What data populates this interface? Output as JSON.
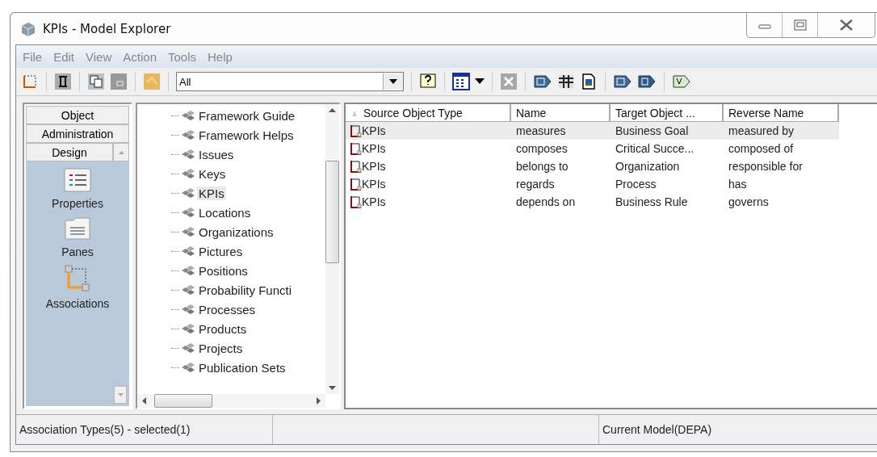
{
  "window": {
    "title": "KPIs - Model Explorer"
  },
  "menu": [
    "File",
    "Edit",
    "View",
    "Action",
    "Tools",
    "Help"
  ],
  "toolbar": {
    "filter_value": "All"
  },
  "nav": {
    "sections": [
      "Object",
      "Administration",
      "Design"
    ],
    "items": [
      {
        "label": "Properties",
        "kind": "properties"
      },
      {
        "label": "Panes",
        "kind": "panes"
      },
      {
        "label": "Associations",
        "kind": "associations"
      }
    ]
  },
  "tree": {
    "items": [
      {
        "label": "Framework Guide",
        "selected": false
      },
      {
        "label": "Framework Helps",
        "selected": false
      },
      {
        "label": "Issues",
        "selected": false
      },
      {
        "label": "Keys",
        "selected": false
      },
      {
        "label": "KPIs",
        "selected": true
      },
      {
        "label": "Locations",
        "selected": false
      },
      {
        "label": "Organizations",
        "selected": false
      },
      {
        "label": "Pictures",
        "selected": false
      },
      {
        "label": "Positions",
        "selected": false
      },
      {
        "label": "Probability Functi",
        "selected": false
      },
      {
        "label": "Processes",
        "selected": false
      },
      {
        "label": "Products",
        "selected": false
      },
      {
        "label": "Projects",
        "selected": false
      },
      {
        "label": "Publication Sets",
        "selected": false
      }
    ]
  },
  "table": {
    "columns": [
      "Source Object Type",
      "Name",
      "Target Object ...",
      "Reverse Name"
    ],
    "rows": [
      {
        "cells": [
          "KPIs",
          "measures",
          "Business Goal",
          "measured by"
        ],
        "selected": true
      },
      {
        "cells": [
          "KPIs",
          "composes",
          "Critical Succe...",
          "composed of"
        ],
        "selected": false
      },
      {
        "cells": [
          "KPIs",
          "belongs to",
          "Organization",
          "responsible for"
        ],
        "selected": false
      },
      {
        "cells": [
          "KPIs",
          "regards",
          "Process",
          "has"
        ],
        "selected": false
      },
      {
        "cells": [
          "KPIs",
          "depends on",
          "Business Rule",
          "governs"
        ],
        "selected": false
      }
    ]
  },
  "status_bar": {
    "left": "Association Types(5) - selected(1)",
    "right": "Current Model(DEPA)"
  }
}
